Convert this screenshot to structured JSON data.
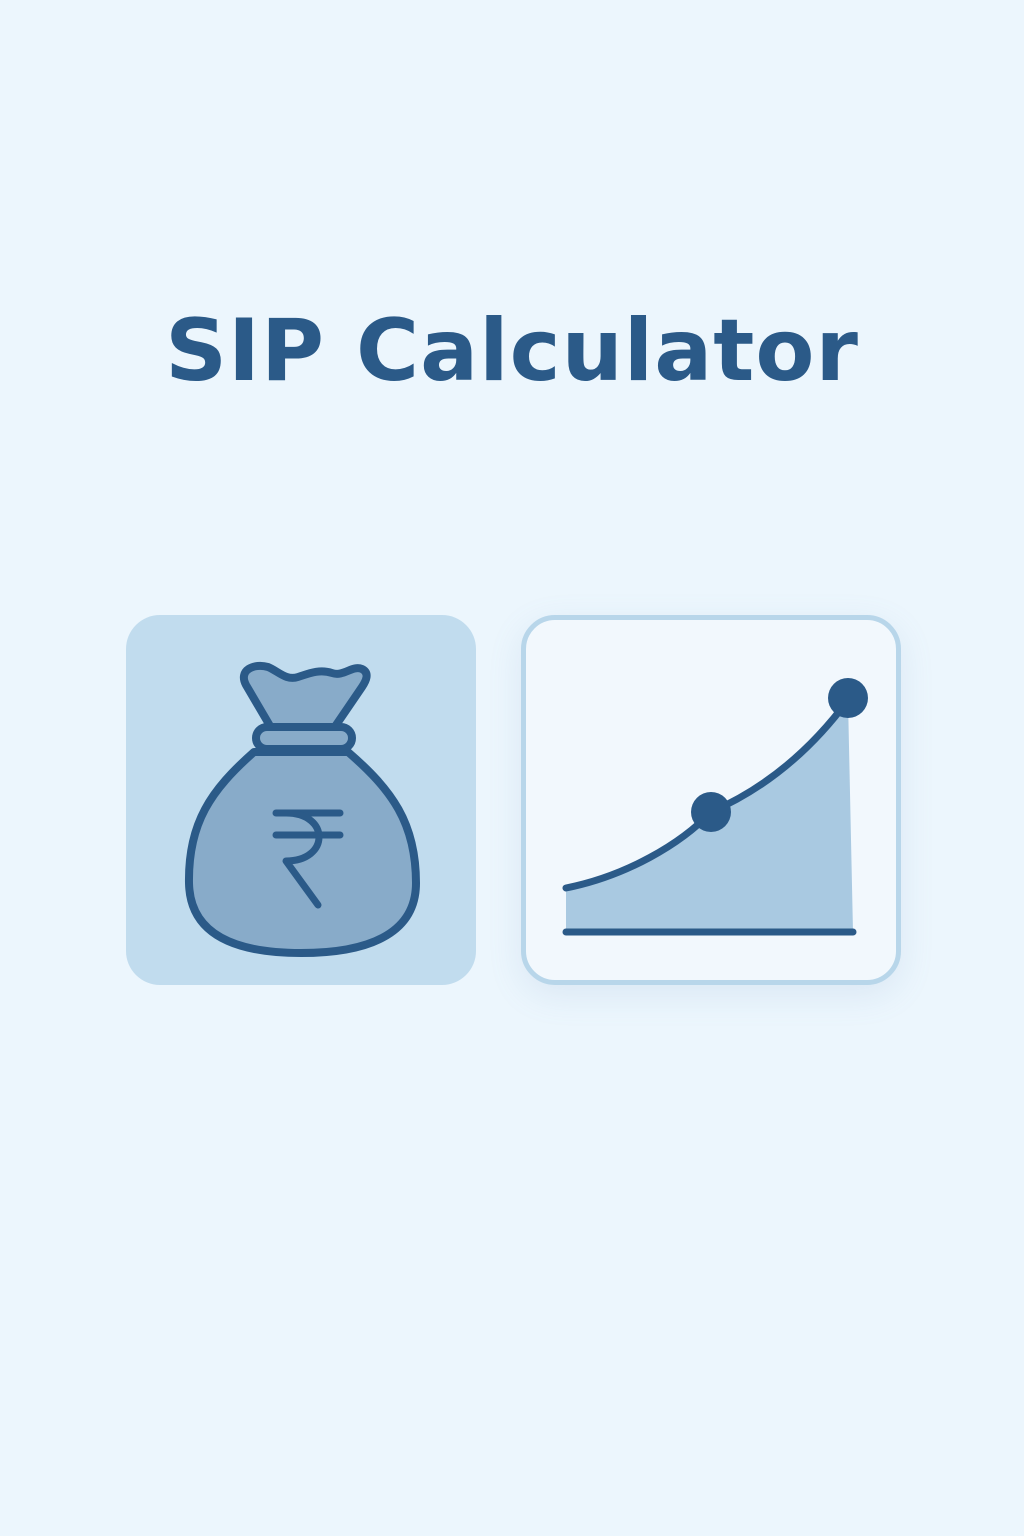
{
  "title": "SIP Calculator",
  "icons": {
    "left_tile": "money-bag-rupee-icon",
    "right_tile": "growth-chart-icon",
    "currency_symbol": "₹"
  },
  "colors": {
    "background": "#ecf6fd",
    "title": "#2b5a88",
    "stroke": "#2b5a88",
    "left_tile_bg": "#c1dcee",
    "bag_fill": "#88abc9",
    "right_tile_bg": "#f2f8fd",
    "right_tile_border": "#b8d6ea",
    "chart_area": "#a9c9e1"
  }
}
